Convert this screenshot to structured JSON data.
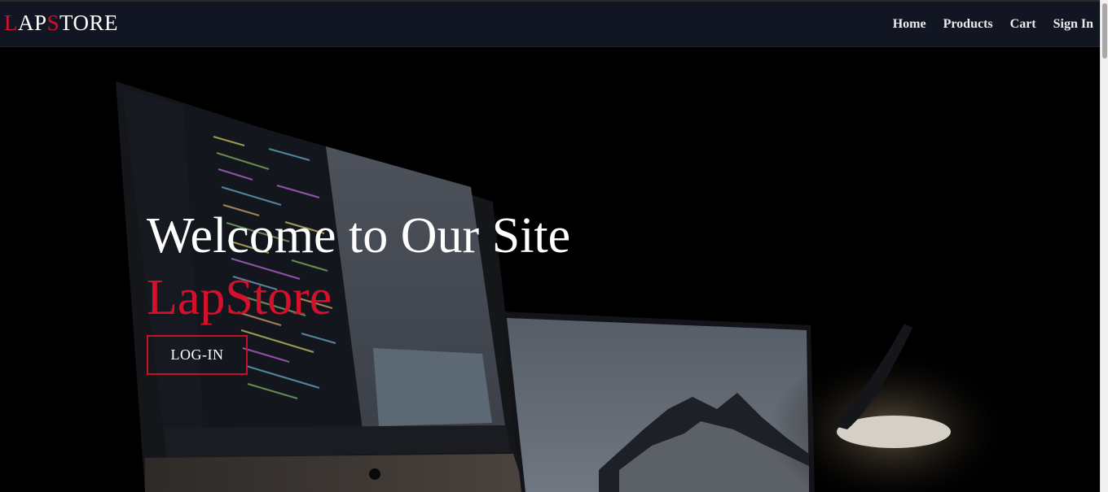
{
  "navbar": {
    "logo": {
      "part1": "L",
      "part2": "AP",
      "part3": "S",
      "part4": "TORE"
    },
    "links": [
      "Home",
      "Products",
      "Cart",
      "Sign In"
    ]
  },
  "hero": {
    "heading": "Welcome to Our Site",
    "brand": "LapStore",
    "login_label": "LOG-IN"
  },
  "colors": {
    "accent": "#d3112d",
    "navbar_bg": "#111622",
    "text": "#ffffff"
  }
}
